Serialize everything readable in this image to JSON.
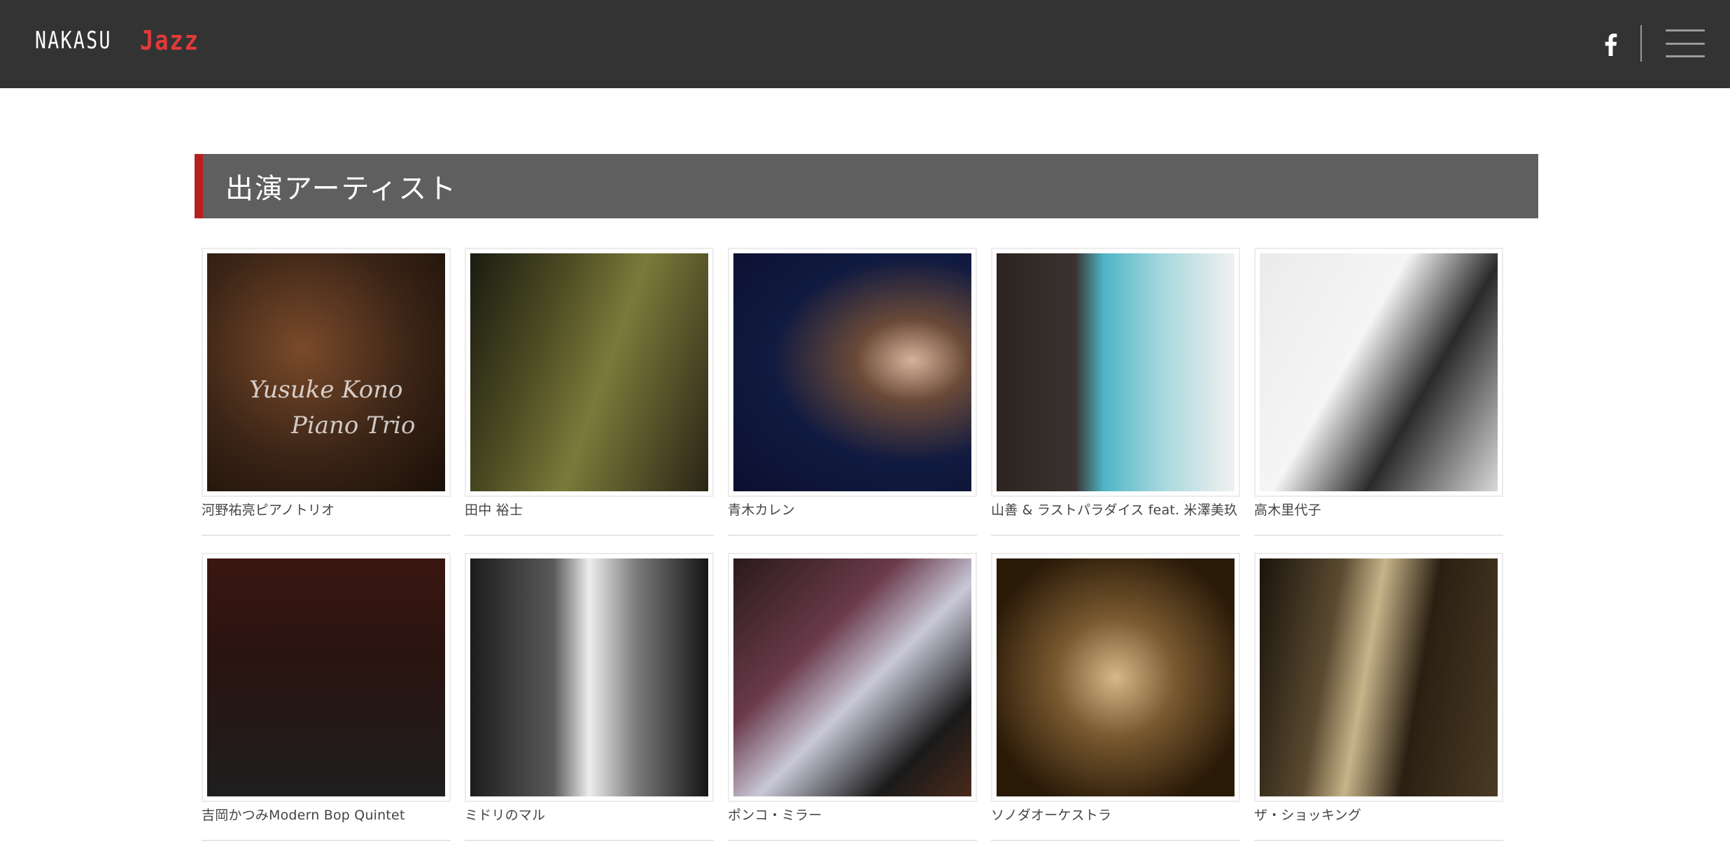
{
  "header": {
    "logo_nakasu": "NAKASU",
    "logo_jazz": "Jazz",
    "brand_color": "#e13a3a",
    "background_color": "#333333",
    "facebook_icon": "facebook-icon",
    "menu_icon": "hamburger-menu-icon"
  },
  "section": {
    "title": "出演アーティスト",
    "accent_color": "#b8201f"
  },
  "artists": [
    {
      "name": "河野祐亮ピアノトリオ",
      "photo_text_1": "Yusuke Kono",
      "photo_text_2": "Piano Trio"
    },
    {
      "name": "田中 裕士"
    },
    {
      "name": "青木カレン"
    },
    {
      "name": "山善 & ラストパラダイス feat. 米澤美玖"
    },
    {
      "name": "高木里代子"
    },
    {
      "name": "吉岡かつみModern Bop Quintet"
    },
    {
      "name": "ミドリのマル"
    },
    {
      "name": "ポンコ・ミラー"
    },
    {
      "name": "ソノダオーケストラ"
    },
    {
      "name": "ザ・ショッキング"
    }
  ]
}
